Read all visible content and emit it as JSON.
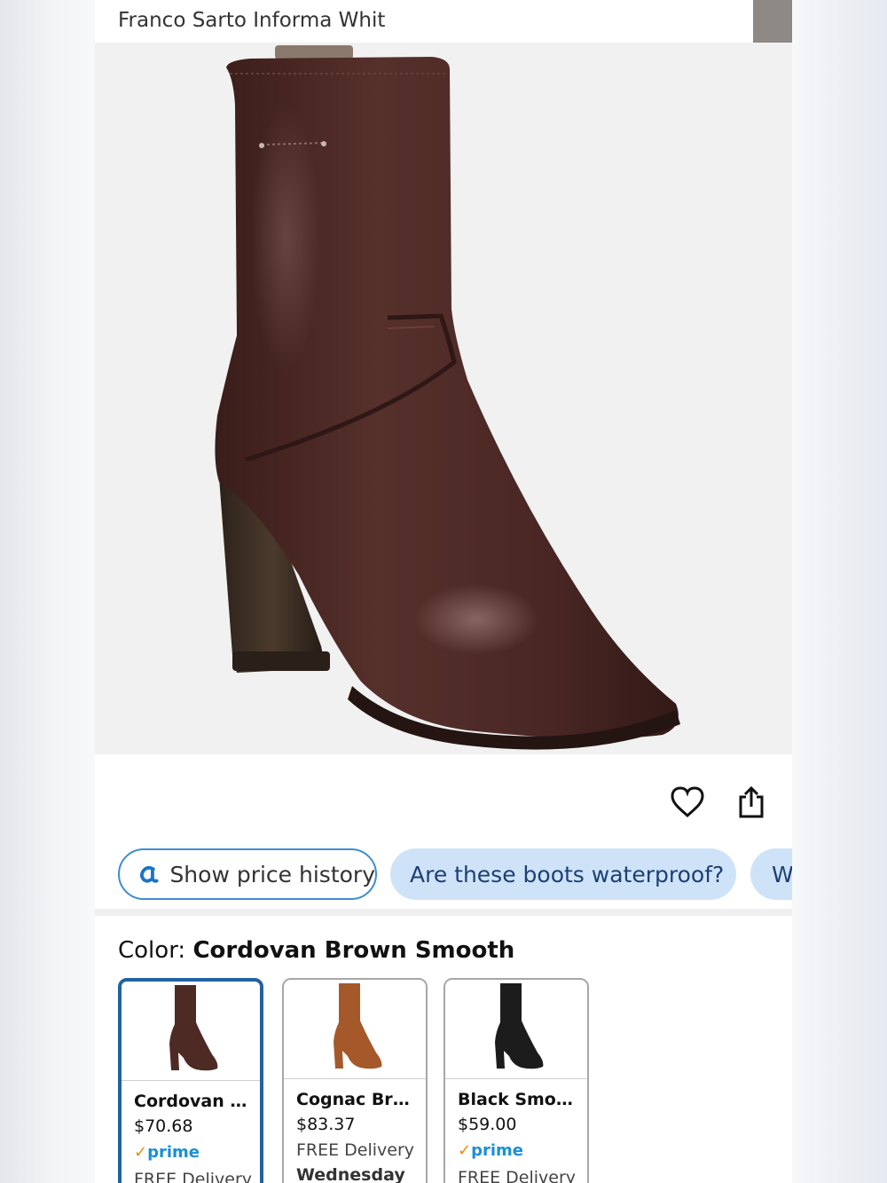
{
  "header": {
    "title": "Franco Sarto Informa Whit"
  },
  "product_image": {
    "icon": "boot-product-image",
    "colors": {
      "leather": "#4a2724",
      "heel": "#3a2a20",
      "background": "#f1f1f1"
    }
  },
  "actions": {
    "favorite_icon": "heart-icon",
    "share_icon": "share-icon"
  },
  "chips": {
    "price_history": {
      "icon": "keepa-logo-icon",
      "label": "Show price history"
    },
    "question": "Are these boots waterproof?",
    "cut_chip": "W"
  },
  "color_section": {
    "label": "Color:",
    "selected": "Cordovan Brown Smooth"
  },
  "swatches": [
    {
      "name": "Cordovan B...",
      "price": "$70.68",
      "prime": "prime",
      "delivery": "FREE Delivery",
      "color": "#4e2a24",
      "selected": true
    },
    {
      "name": "Cognac Bro...",
      "price": "$83.37",
      "delivery": "FREE Delivery",
      "delivery_day": "Wednesday",
      "color": "#a5592a",
      "selected": false
    },
    {
      "name": "Black Smooth",
      "price": "$59.00",
      "prime": "prime",
      "delivery": "FREE Delivery",
      "color": "#1c1c1c",
      "selected": false
    }
  ],
  "theme": {
    "accent_blue": "#2162a1",
    "chip_blue": "#cfe3f8",
    "prime_blue": "#1a8fd6",
    "prime_check": "#f08804"
  }
}
